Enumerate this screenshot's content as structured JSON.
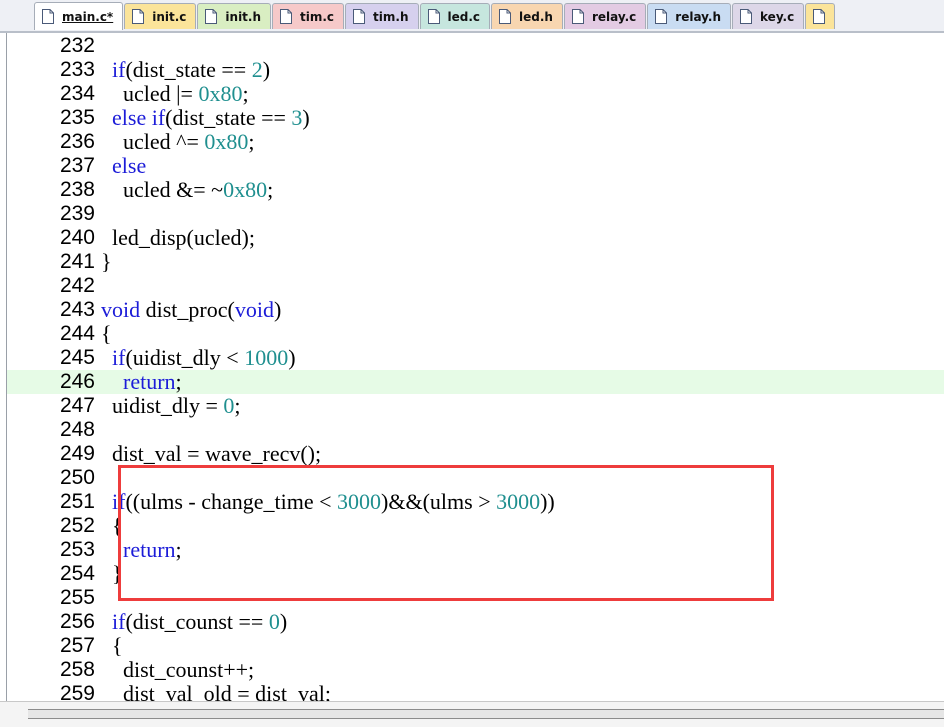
{
  "tabs": [
    {
      "label": "main.c*",
      "color": "#ffffff",
      "active": true,
      "icon": "c-file-icon"
    },
    {
      "label": "init.c",
      "color": "#fbe49a",
      "active": false,
      "icon": "c-file-icon"
    },
    {
      "label": "init.h",
      "color": "#d9eec2",
      "active": false,
      "icon": "h-file-icon"
    },
    {
      "label": "tim.c",
      "color": "#f6c9c9",
      "active": false,
      "icon": "c-file-icon"
    },
    {
      "label": "tim.h",
      "color": "#d6d0ee",
      "active": false,
      "icon": "h-file-icon"
    },
    {
      "label": "led.c",
      "color": "#c6e6de",
      "active": false,
      "icon": "c-file-icon"
    },
    {
      "label": "led.h",
      "color": "#f8d6b0",
      "active": false,
      "icon": "h-file-icon"
    },
    {
      "label": "relay.c",
      "color": "#e3cbe3",
      "active": false,
      "icon": "c-file-icon"
    },
    {
      "label": "relay.h",
      "color": "#c9dcf2",
      "active": false,
      "icon": "h-file-icon"
    },
    {
      "label": "key.c",
      "color": "#ddd7e8",
      "active": false,
      "icon": "c-file-icon"
    },
    {
      "label": "",
      "color": "#fbe49a",
      "active": false,
      "icon": "c-file-icon"
    }
  ],
  "code_lines": [
    {
      "num": "232",
      "tokens": []
    },
    {
      "num": "233",
      "tokens": [
        {
          "t": "  "
        },
        {
          "t": "if",
          "c": "kw"
        },
        {
          "t": "(dist_state == "
        },
        {
          "t": "2",
          "c": "num"
        },
        {
          "t": ")"
        }
      ]
    },
    {
      "num": "234",
      "tokens": [
        {
          "t": "    ucled |= "
        },
        {
          "t": "0x80",
          "c": "num"
        },
        {
          "t": ";"
        }
      ]
    },
    {
      "num": "235",
      "tokens": [
        {
          "t": "  "
        },
        {
          "t": "else if",
          "c": "kw"
        },
        {
          "t": "(dist_state == "
        },
        {
          "t": "3",
          "c": "num"
        },
        {
          "t": ")"
        }
      ]
    },
    {
      "num": "236",
      "tokens": [
        {
          "t": "    ucled ^= "
        },
        {
          "t": "0x80",
          "c": "num"
        },
        {
          "t": ";"
        }
      ]
    },
    {
      "num": "237",
      "tokens": [
        {
          "t": "  "
        },
        {
          "t": "else",
          "c": "kw"
        }
      ]
    },
    {
      "num": "238",
      "tokens": [
        {
          "t": "    ucled &= ~"
        },
        {
          "t": "0x80",
          "c": "num"
        },
        {
          "t": ";"
        }
      ]
    },
    {
      "num": "239",
      "tokens": []
    },
    {
      "num": "240",
      "tokens": [
        {
          "t": "  led_disp(ucled);"
        }
      ]
    },
    {
      "num": "241",
      "tokens": [
        {
          "t": "}"
        }
      ]
    },
    {
      "num": "242",
      "tokens": []
    },
    {
      "num": "243",
      "tokens": [
        {
          "t": "void",
          "c": "kw"
        },
        {
          "t": " dist_proc("
        },
        {
          "t": "void",
          "c": "kw"
        },
        {
          "t": ")"
        }
      ]
    },
    {
      "num": "244",
      "tokens": [
        {
          "t": "{"
        }
      ]
    },
    {
      "num": "245",
      "tokens": [
        {
          "t": "  "
        },
        {
          "t": "if",
          "c": "kw"
        },
        {
          "t": "(uidist_dly < "
        },
        {
          "t": "1000",
          "c": "num"
        },
        {
          "t": ")"
        }
      ]
    },
    {
      "num": "246",
      "tokens": [
        {
          "t": "    "
        },
        {
          "t": "return",
          "c": "kw"
        },
        {
          "t": ";"
        }
      ],
      "highlight": true
    },
    {
      "num": "247",
      "tokens": [
        {
          "t": "  uidist_dly = "
        },
        {
          "t": "0",
          "c": "num"
        },
        {
          "t": ";"
        }
      ]
    },
    {
      "num": "248",
      "tokens": []
    },
    {
      "num": "249",
      "tokens": [
        {
          "t": "  dist_val = wave_recv();"
        }
      ]
    },
    {
      "num": "250",
      "tokens": []
    },
    {
      "num": "251",
      "tokens": [
        {
          "t": "  "
        },
        {
          "t": "if",
          "c": "kw"
        },
        {
          "t": "((ulms - change_time < "
        },
        {
          "t": "3000",
          "c": "num"
        },
        {
          "t": ")&&(ulms > "
        },
        {
          "t": "3000",
          "c": "num"
        },
        {
          "t": "))"
        }
      ]
    },
    {
      "num": "252",
      "tokens": [
        {
          "t": "  {"
        }
      ]
    },
    {
      "num": "253",
      "tokens": [
        {
          "t": "    "
        },
        {
          "t": "return",
          "c": "kw"
        },
        {
          "t": ";"
        }
      ]
    },
    {
      "num": "254",
      "tokens": [
        {
          "t": "  }"
        }
      ]
    },
    {
      "num": "255",
      "tokens": []
    },
    {
      "num": "256",
      "tokens": [
        {
          "t": "  "
        },
        {
          "t": "if",
          "c": "kw"
        },
        {
          "t": "(dist_counst == "
        },
        {
          "t": "0",
          "c": "num"
        },
        {
          "t": ")"
        }
      ]
    },
    {
      "num": "257",
      "tokens": [
        {
          "t": "  {"
        }
      ]
    },
    {
      "num": "258",
      "tokens": [
        {
          "t": "    dist_counst++;"
        }
      ]
    },
    {
      "num": "259",
      "tokens": [
        {
          "t": "    dist_val_old = dist_val;"
        }
      ]
    }
  ],
  "colors": {
    "keyword": "#1c1cd8",
    "number": "#1f8f8f",
    "current_line": "#e6fbe6",
    "annotation_box": "#ee3c3c"
  }
}
